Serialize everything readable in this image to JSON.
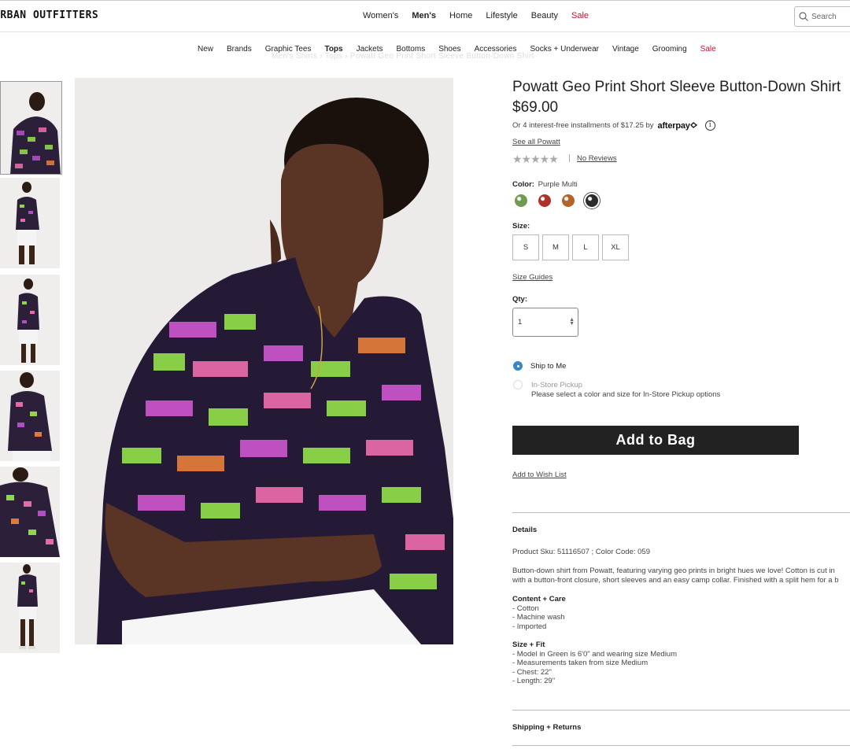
{
  "header": {
    "logo": "URBAN OUTFITTERS",
    "main_nav": [
      {
        "label": "Women's",
        "active": false,
        "sale": false
      },
      {
        "label": "Men's",
        "active": true,
        "sale": false
      },
      {
        "label": "Home",
        "active": false,
        "sale": false
      },
      {
        "label": "Lifestyle",
        "active": false,
        "sale": false
      },
      {
        "label": "Beauty",
        "active": false,
        "sale": false
      },
      {
        "label": "Sale",
        "active": false,
        "sale": true
      }
    ],
    "search_placeholder": "Search"
  },
  "sub_nav": [
    {
      "label": "New",
      "active": false,
      "sale": false
    },
    {
      "label": "Brands",
      "active": false,
      "sale": false
    },
    {
      "label": "Graphic Tees",
      "active": false,
      "sale": false
    },
    {
      "label": "Tops",
      "active": true,
      "sale": false
    },
    {
      "label": "Jackets",
      "active": false,
      "sale": false
    },
    {
      "label": "Bottoms",
      "active": false,
      "sale": false
    },
    {
      "label": "Shoes",
      "active": false,
      "sale": false
    },
    {
      "label": "Accessories",
      "active": false,
      "sale": false
    },
    {
      "label": "Socks + Underwear",
      "active": false,
      "sale": false
    },
    {
      "label": "Vintage",
      "active": false,
      "sale": false
    },
    {
      "label": "Grooming",
      "active": false,
      "sale": false
    },
    {
      "label": "Sale",
      "active": false,
      "sale": true
    }
  ],
  "product": {
    "title": "Powatt Geo Print Short Sleeve Button-Down Shirt",
    "price": "$69.00",
    "installments": "Or 4 interest-free installments of $17.25 by",
    "afterpay": "afterpay",
    "info_icon": "i",
    "see_all": "See all Powatt",
    "stars": "★★★★★",
    "reviews": "No Reviews",
    "color_label": "Color:",
    "color_value": "Purple Multi",
    "swatches": [
      {
        "color": "#6f9a52",
        "selected": false
      },
      {
        "color": "#b0302c",
        "selected": false
      },
      {
        "color": "#b4642a",
        "selected": false
      },
      {
        "color": "#2b2b2b",
        "selected": true
      }
    ],
    "size_label": "Size:",
    "sizes": [
      "S",
      "M",
      "L",
      "XL"
    ],
    "size_guides": "Size Guides",
    "qty_label": "Qty:",
    "qty_value": "1",
    "ship_to_me": "Ship to Me",
    "in_store_pickup": "In-Store Pickup",
    "pickup_note": "Please select a color and size for In-Store Pickup options",
    "add_to_bag": "Add to Bag",
    "wish_list": "Add to Wish List",
    "details_heading": "Details",
    "sku_line": "Product Sku: 51116507 ; Color Code: 059",
    "description_1": "Button-down shirt from Powatt, featuring varying geo prints in bright hues we love! Cotton is cut in",
    "description_2": "with a button-front closure, short sleeves and an easy camp collar. Finished with a split hem for a b",
    "content_heading": "Content + Care",
    "content_items": [
      "- Cotton",
      "- Machine wash",
      "- Imported"
    ],
    "fit_heading": "Size + Fit",
    "fit_items": [
      "- Model in Green is 6'0\" and wearing size Medium",
      "- Measurements taken from size Medium",
      "- Chest: 22\"",
      "- Length: 29\""
    ],
    "shipping_heading": "Shipping + Returns"
  },
  "breadcrumb_ghost": "Men's Shirts  ›  Tops  ›  Powatt Geo Print Short Sleeve Button-Down Shirt"
}
